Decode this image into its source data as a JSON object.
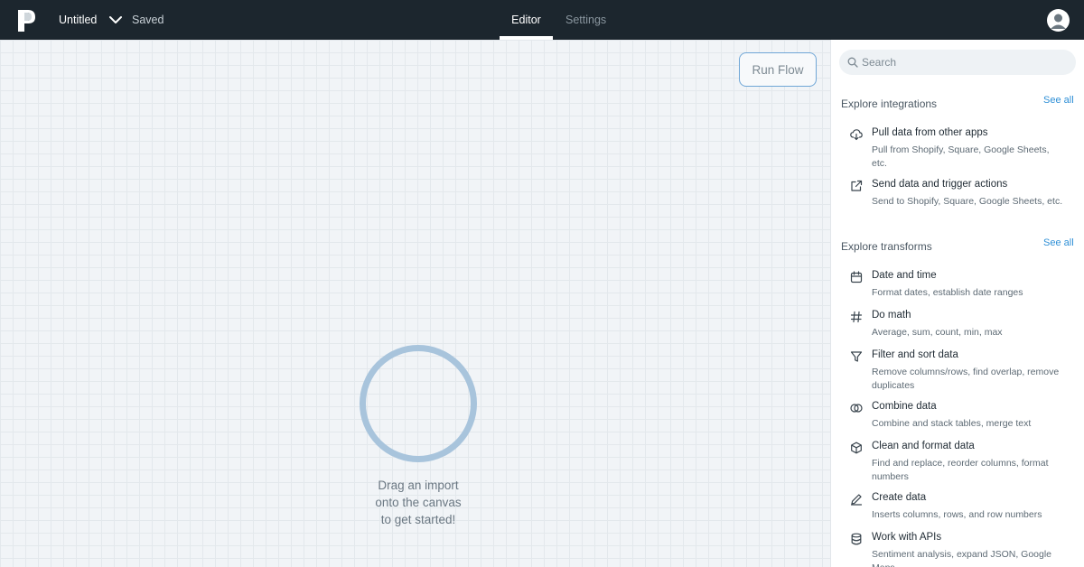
{
  "app": {
    "doc_title": "Untitled",
    "save_status": "Saved"
  },
  "tabs": {
    "editor": "Editor",
    "settings": "Settings"
  },
  "canvas": {
    "run_label": "Run Flow",
    "hint_line1": "Drag an import",
    "hint_line2": "onto the canvas",
    "hint_line3": "to get started!"
  },
  "sidebar": {
    "search_placeholder": "Search",
    "integrations": {
      "title": "Explore integrations",
      "see_all": "See all",
      "items": [
        {
          "icon": "cloud-download-icon",
          "title": "Pull data from other apps",
          "desc": "Pull from Shopify, Square, Google Sheets, etc."
        },
        {
          "icon": "external-link-icon",
          "title": "Send data and trigger actions",
          "desc": "Send to Shopify, Square, Google Sheets, etc."
        }
      ]
    },
    "transforms": {
      "title": "Explore transforms",
      "see_all": "See all",
      "items": [
        {
          "icon": "calendar-icon",
          "title": "Date and time",
          "desc": "Format dates, establish date ranges"
        },
        {
          "icon": "hash-icon",
          "title": "Do math",
          "desc": "Average, sum, count, min, max"
        },
        {
          "icon": "filter-icon",
          "title": "Filter and sort data",
          "desc": "Remove columns/rows, find overlap, remove duplicates"
        },
        {
          "icon": "combine-icon",
          "title": "Combine data",
          "desc": "Combine and stack tables, merge text"
        },
        {
          "icon": "cube-icon",
          "title": "Clean and format data",
          "desc": "Find and replace, reorder columns, format numbers"
        },
        {
          "icon": "pencil-icon",
          "title": "Create data",
          "desc": "Inserts columns, rows, and row numbers"
        },
        {
          "icon": "database-icon",
          "title": "Work with APIs",
          "desc": "Sentiment analysis, expand JSON, Google Maps"
        }
      ]
    }
  }
}
